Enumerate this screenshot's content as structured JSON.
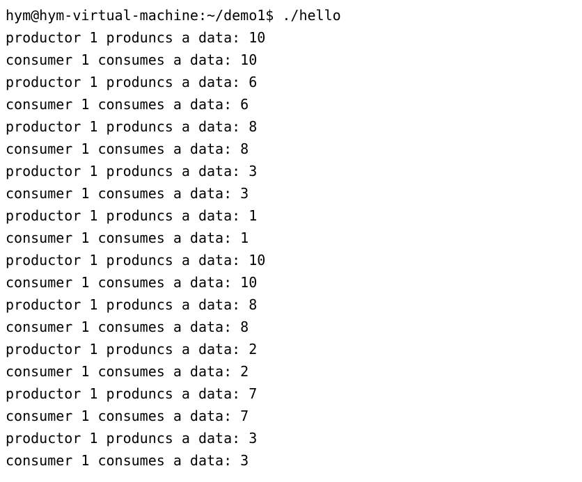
{
  "prompt": {
    "user_host": "hym@hym-virtual-machine",
    "colon": ":",
    "path": "~/demo1",
    "dollar": "$ ",
    "command": "./hello"
  },
  "output": [
    "productor 1 produncs a data: 10",
    "consumer 1 consumes a data: 10",
    "productor 1 produncs a data: 6",
    "consumer 1 consumes a data: 6",
    "productor 1 produncs a data: 8",
    "consumer 1 consumes a data: 8",
    "productor 1 produncs a data: 3",
    "consumer 1 consumes a data: 3",
    "productor 1 produncs a data: 1",
    "consumer 1 consumes a data: 1",
    "productor 1 produncs a data: 10",
    "consumer 1 consumes a data: 10",
    "productor 1 produncs a data: 8",
    "consumer 1 consumes a data: 8",
    "productor 1 produncs a data: 2",
    "consumer 1 consumes a data: 2",
    "productor 1 produncs a data: 7",
    "consumer 1 consumes a data: 7",
    "productor 1 produncs a data: 3",
    "consumer 1 consumes a data: 3"
  ]
}
